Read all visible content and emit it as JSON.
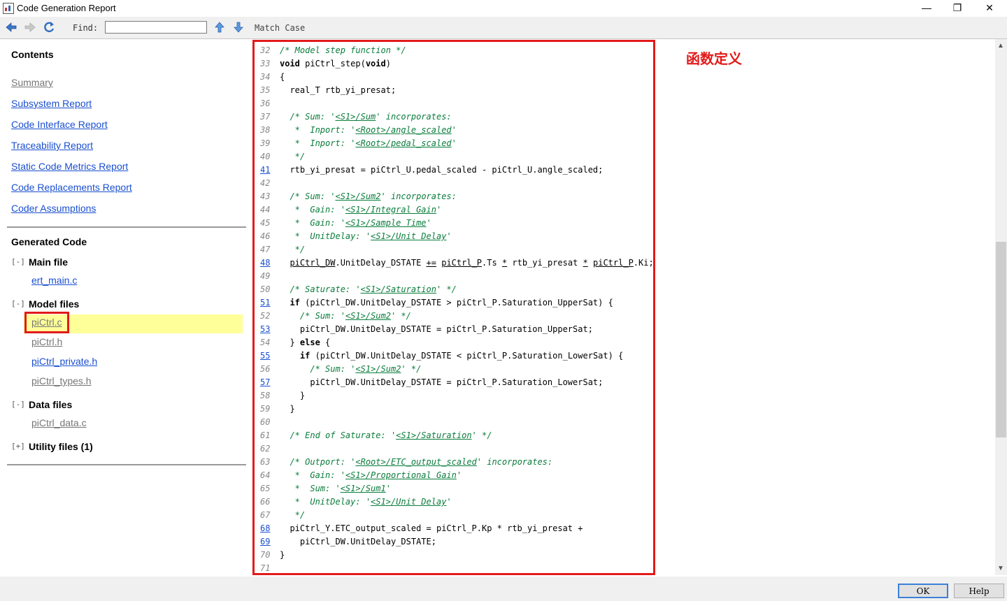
{
  "window": {
    "title": "Code Generation Report",
    "minimize_glyph": "—",
    "maximize_glyph": "❐",
    "close_glyph": "✕"
  },
  "toolbar": {
    "find_label": "Find:",
    "find_value": "",
    "match_case_label": "Match Case",
    "icons": [
      "back-arrow-icon",
      "forward-arrow-icon",
      "refresh-icon",
      "find-previous-icon",
      "find-next-icon"
    ]
  },
  "contents": {
    "title": "Contents",
    "links": [
      {
        "label": "Summary",
        "visited": true
      },
      {
        "label": "Subsystem Report",
        "visited": false
      },
      {
        "label": "Code Interface Report",
        "visited": false
      },
      {
        "label": "Traceability Report",
        "visited": false
      },
      {
        "label": "Static Code Metrics Report",
        "visited": false
      },
      {
        "label": "Code Replacements Report",
        "visited": false
      },
      {
        "label": "Coder Assumptions",
        "visited": false
      }
    ]
  },
  "generated_code": {
    "title": "Generated Code",
    "groups": [
      {
        "toggle": "[-]",
        "label": "Main file",
        "files": [
          {
            "name": "ert_main.c",
            "visited": false
          }
        ]
      },
      {
        "toggle": "[-]",
        "label": "Model files",
        "files": [
          {
            "name": "piCtrl.c",
            "visited": true,
            "selected": true
          },
          {
            "name": "piCtrl.h",
            "visited": true
          },
          {
            "name": "piCtrl_private.h",
            "visited": false
          },
          {
            "name": "piCtrl_types.h",
            "visited": true
          }
        ]
      },
      {
        "toggle": "[-]",
        "label": "Data files",
        "files": [
          {
            "name": "piCtrl_data.c",
            "visited": true
          }
        ]
      },
      {
        "toggle": "[+]",
        "label": "Utility files (1)",
        "files": []
      }
    ]
  },
  "annotation": "函数定义",
  "code": {
    "lines": [
      {
        "n": "32",
        "link": false,
        "html": "<span class='cm'>/* Model step function */</span>"
      },
      {
        "n": "33",
        "link": false,
        "html": "<span class='kw'>void</span> piCtrl_step(<span class='kw'>void</span>)"
      },
      {
        "n": "34",
        "link": false,
        "html": "{"
      },
      {
        "n": "35",
        "link": false,
        "html": "  real_T rtb_yi_presat;"
      },
      {
        "n": "36",
        "link": false,
        "html": ""
      },
      {
        "n": "37",
        "link": false,
        "html": "  <span class='cm'>/* Sum: '<u>&lt;S1&gt;/Sum</u>' incorporates:</span>"
      },
      {
        "n": "38",
        "link": false,
        "html": "  <span class='cm'> *  Inport: '<u>&lt;Root&gt;/angle_scaled</u>'</span>"
      },
      {
        "n": "39",
        "link": false,
        "html": "  <span class='cm'> *  Inport: '<u>&lt;Root&gt;/pedal_scaled</u>'</span>"
      },
      {
        "n": "40",
        "link": false,
        "html": "  <span class='cm'> */</span>"
      },
      {
        "n": "41",
        "link": true,
        "html": "  rtb_yi_presat = piCtrl_U.pedal_scaled - piCtrl_U.angle_scaled;"
      },
      {
        "n": "42",
        "link": false,
        "html": ""
      },
      {
        "n": "43",
        "link": false,
        "html": "  <span class='cm'>/* Sum: '<u>&lt;S1&gt;/Sum2</u>' incorporates:</span>"
      },
      {
        "n": "44",
        "link": false,
        "html": "  <span class='cm'> *  Gain: '<u>&lt;S1&gt;/Integral Gain</u>'</span>"
      },
      {
        "n": "45",
        "link": false,
        "html": "  <span class='cm'> *  Gain: '<u>&lt;S1&gt;/Sample Time</u>'</span>"
      },
      {
        "n": "46",
        "link": false,
        "html": "  <span class='cm'> *  UnitDelay: '<u>&lt;S1&gt;/Unit Delay</u>'</span>"
      },
      {
        "n": "47",
        "link": false,
        "html": "  <span class='cm'> */</span>"
      },
      {
        "n": "48",
        "link": true,
        "html": "  <span class='lk'>piCtrl_DW</span>.UnitDelay_DSTATE <span class='lk'>+=</span> <span class='lk'>piCtrl_P</span>.Ts <span class='lk'>*</span> rtb_yi_presat <span class='lk'>*</span> <span class='lk'>piCtrl_P</span>.Ki;"
      },
      {
        "n": "49",
        "link": false,
        "html": ""
      },
      {
        "n": "50",
        "link": false,
        "html": "  <span class='cm'>/* Saturate: '<u>&lt;S1&gt;/Saturation</u>' */</span>"
      },
      {
        "n": "51",
        "link": true,
        "html": "  <span class='kw'>if</span> (piCtrl_DW.UnitDelay_DSTATE &gt; piCtrl_P.Saturation_UpperSat) {"
      },
      {
        "n": "52",
        "link": false,
        "html": "    <span class='cm'>/* Sum: '<u>&lt;S1&gt;/Sum2</u>' */</span>"
      },
      {
        "n": "53",
        "link": true,
        "html": "    piCtrl_DW.UnitDelay_DSTATE = piCtrl_P.Saturation_UpperSat;"
      },
      {
        "n": "54",
        "link": false,
        "html": "  } <span class='kw'>else</span> {"
      },
      {
        "n": "55",
        "link": true,
        "html": "    <span class='kw'>if</span> (piCtrl_DW.UnitDelay_DSTATE &lt; piCtrl_P.Saturation_LowerSat) {"
      },
      {
        "n": "56",
        "link": false,
        "html": "      <span class='cm'>/* Sum: '<u>&lt;S1&gt;/Sum2</u>' */</span>"
      },
      {
        "n": "57",
        "link": true,
        "html": "      piCtrl_DW.UnitDelay_DSTATE = piCtrl_P.Saturation_LowerSat;"
      },
      {
        "n": "58",
        "link": false,
        "html": "    }"
      },
      {
        "n": "59",
        "link": false,
        "html": "  }"
      },
      {
        "n": "60",
        "link": false,
        "html": ""
      },
      {
        "n": "61",
        "link": false,
        "html": "  <span class='cm'>/* End of Saturate: '<u>&lt;S1&gt;/Saturation</u>' */</span>"
      },
      {
        "n": "62",
        "link": false,
        "html": ""
      },
      {
        "n": "63",
        "link": false,
        "html": "  <span class='cm'>/* Outport: '<u>&lt;Root&gt;/ETC_output_scaled</u>' incorporates:</span>"
      },
      {
        "n": "64",
        "link": false,
        "html": "  <span class='cm'> *  Gain: '<u>&lt;S1&gt;/Proportional Gain</u>'</span>"
      },
      {
        "n": "65",
        "link": false,
        "html": "  <span class='cm'> *  Sum: '<u>&lt;S1&gt;/Sum1</u>'</span>"
      },
      {
        "n": "66",
        "link": false,
        "html": "  <span class='cm'> *  UnitDelay: '<u>&lt;S1&gt;/Unit Delay</u>'</span>"
      },
      {
        "n": "67",
        "link": false,
        "html": "  <span class='cm'> */</span>"
      },
      {
        "n": "68",
        "link": true,
        "html": "  piCtrl_Y.ETC_output_scaled = piCtrl_P.Kp * rtb_yi_presat +"
      },
      {
        "n": "69",
        "link": true,
        "html": "    piCtrl_DW.UnitDelay_DSTATE;"
      },
      {
        "n": "70",
        "link": false,
        "html": "}"
      },
      {
        "n": "71",
        "link": false,
        "html": ""
      }
    ]
  },
  "buttons": {
    "ok": "OK",
    "help": "Help"
  },
  "colors": {
    "highlight_box": "#e21a1a",
    "link": "#1a4fd0",
    "comment": "#0a7d3c",
    "selected_row": "#ffff99"
  }
}
